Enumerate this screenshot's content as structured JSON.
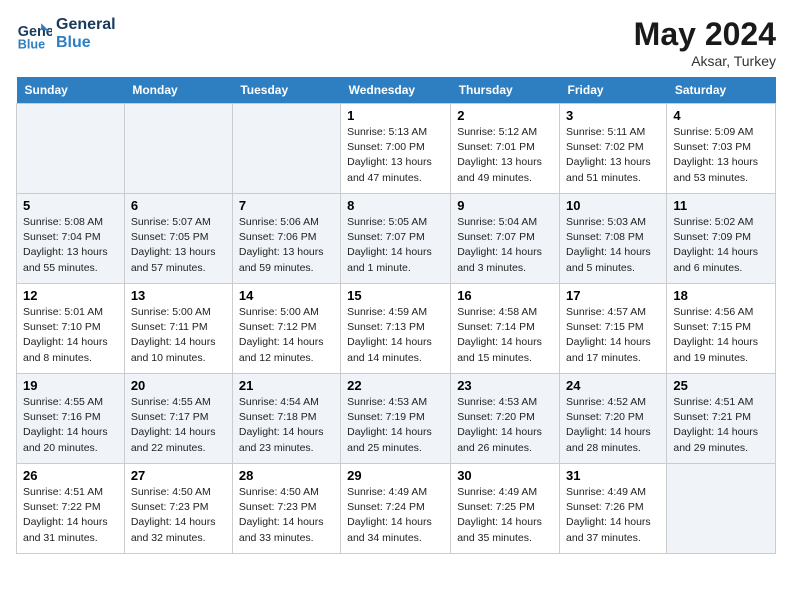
{
  "header": {
    "logo_line1": "General",
    "logo_line2": "Blue",
    "month_year": "May 2024",
    "location": "Aksar, Turkey"
  },
  "days_of_week": [
    "Sunday",
    "Monday",
    "Tuesday",
    "Wednesday",
    "Thursday",
    "Friday",
    "Saturday"
  ],
  "weeks": [
    [
      {
        "num": "",
        "empty": true
      },
      {
        "num": "",
        "empty": true
      },
      {
        "num": "",
        "empty": true
      },
      {
        "num": "1",
        "sunrise": "5:13 AM",
        "sunset": "7:00 PM",
        "daylight": "13 hours and 47 minutes."
      },
      {
        "num": "2",
        "sunrise": "5:12 AM",
        "sunset": "7:01 PM",
        "daylight": "13 hours and 49 minutes."
      },
      {
        "num": "3",
        "sunrise": "5:11 AM",
        "sunset": "7:02 PM",
        "daylight": "13 hours and 51 minutes."
      },
      {
        "num": "4",
        "sunrise": "5:09 AM",
        "sunset": "7:03 PM",
        "daylight": "13 hours and 53 minutes."
      }
    ],
    [
      {
        "num": "5",
        "sunrise": "5:08 AM",
        "sunset": "7:04 PM",
        "daylight": "13 hours and 55 minutes."
      },
      {
        "num": "6",
        "sunrise": "5:07 AM",
        "sunset": "7:05 PM",
        "daylight": "13 hours and 57 minutes."
      },
      {
        "num": "7",
        "sunrise": "5:06 AM",
        "sunset": "7:06 PM",
        "daylight": "13 hours and 59 minutes."
      },
      {
        "num": "8",
        "sunrise": "5:05 AM",
        "sunset": "7:07 PM",
        "daylight": "14 hours and 1 minute."
      },
      {
        "num": "9",
        "sunrise": "5:04 AM",
        "sunset": "7:07 PM",
        "daylight": "14 hours and 3 minutes."
      },
      {
        "num": "10",
        "sunrise": "5:03 AM",
        "sunset": "7:08 PM",
        "daylight": "14 hours and 5 minutes."
      },
      {
        "num": "11",
        "sunrise": "5:02 AM",
        "sunset": "7:09 PM",
        "daylight": "14 hours and 6 minutes."
      }
    ],
    [
      {
        "num": "12",
        "sunrise": "5:01 AM",
        "sunset": "7:10 PM",
        "daylight": "14 hours and 8 minutes."
      },
      {
        "num": "13",
        "sunrise": "5:00 AM",
        "sunset": "7:11 PM",
        "daylight": "14 hours and 10 minutes."
      },
      {
        "num": "14",
        "sunrise": "5:00 AM",
        "sunset": "7:12 PM",
        "daylight": "14 hours and 12 minutes."
      },
      {
        "num": "15",
        "sunrise": "4:59 AM",
        "sunset": "7:13 PM",
        "daylight": "14 hours and 14 minutes."
      },
      {
        "num": "16",
        "sunrise": "4:58 AM",
        "sunset": "7:14 PM",
        "daylight": "14 hours and 15 minutes."
      },
      {
        "num": "17",
        "sunrise": "4:57 AM",
        "sunset": "7:15 PM",
        "daylight": "14 hours and 17 minutes."
      },
      {
        "num": "18",
        "sunrise": "4:56 AM",
        "sunset": "7:15 PM",
        "daylight": "14 hours and 19 minutes."
      }
    ],
    [
      {
        "num": "19",
        "sunrise": "4:55 AM",
        "sunset": "7:16 PM",
        "daylight": "14 hours and 20 minutes."
      },
      {
        "num": "20",
        "sunrise": "4:55 AM",
        "sunset": "7:17 PM",
        "daylight": "14 hours and 22 minutes."
      },
      {
        "num": "21",
        "sunrise": "4:54 AM",
        "sunset": "7:18 PM",
        "daylight": "14 hours and 23 minutes."
      },
      {
        "num": "22",
        "sunrise": "4:53 AM",
        "sunset": "7:19 PM",
        "daylight": "14 hours and 25 minutes."
      },
      {
        "num": "23",
        "sunrise": "4:53 AM",
        "sunset": "7:20 PM",
        "daylight": "14 hours and 26 minutes."
      },
      {
        "num": "24",
        "sunrise": "4:52 AM",
        "sunset": "7:20 PM",
        "daylight": "14 hours and 28 minutes."
      },
      {
        "num": "25",
        "sunrise": "4:51 AM",
        "sunset": "7:21 PM",
        "daylight": "14 hours and 29 minutes."
      }
    ],
    [
      {
        "num": "26",
        "sunrise": "4:51 AM",
        "sunset": "7:22 PM",
        "daylight": "14 hours and 31 minutes."
      },
      {
        "num": "27",
        "sunrise": "4:50 AM",
        "sunset": "7:23 PM",
        "daylight": "14 hours and 32 minutes."
      },
      {
        "num": "28",
        "sunrise": "4:50 AM",
        "sunset": "7:23 PM",
        "daylight": "14 hours and 33 minutes."
      },
      {
        "num": "29",
        "sunrise": "4:49 AM",
        "sunset": "7:24 PM",
        "daylight": "14 hours and 34 minutes."
      },
      {
        "num": "30",
        "sunrise": "4:49 AM",
        "sunset": "7:25 PM",
        "daylight": "14 hours and 35 minutes."
      },
      {
        "num": "31",
        "sunrise": "4:49 AM",
        "sunset": "7:26 PM",
        "daylight": "14 hours and 37 minutes."
      },
      {
        "num": "",
        "empty": true
      }
    ]
  ]
}
